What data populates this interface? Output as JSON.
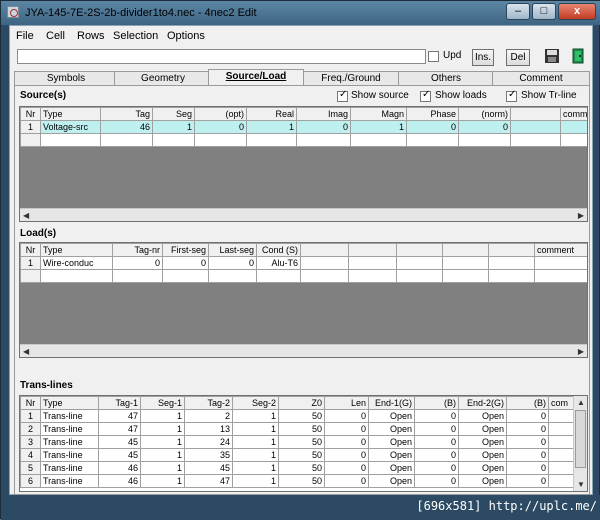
{
  "window": {
    "title": "JYA-145-7E-2S-2b-divider1to4.nec - 4nec2 Edit",
    "minimize": "–",
    "maximize": "□",
    "close": "x"
  },
  "menu": [
    "File",
    "Cell",
    "Rows",
    "Selection",
    "Options"
  ],
  "toolbar": {
    "command_value": "",
    "upd_label": "Upd",
    "upd_checked": false,
    "ins_label": "Ins.",
    "del_label": "Del"
  },
  "tabs": [
    "Symbols",
    "Geometry",
    "Source/Load",
    "Freq./Ground",
    "Others",
    "Comment"
  ],
  "active_tab": "Source/Load",
  "sources": {
    "title": "Source(s)",
    "show_source": "Show source",
    "show_loads": "Show loads",
    "show_trline": "Show Tr-line",
    "headers": [
      "Nr",
      "Type",
      "Tag",
      "Seg",
      "(opt)",
      "Real",
      "Imag",
      "Magn",
      "Phase",
      "(norm)",
      "",
      "comm"
    ],
    "rows": [
      [
        "1",
        "Voltage-src",
        "46",
        "1",
        "0",
        "1",
        "0",
        "1",
        "0",
        "0",
        "",
        ""
      ],
      [
        "",
        "",
        "",
        "",
        "",
        "",
        "",
        "",
        "",
        "",
        "",
        ""
      ]
    ]
  },
  "loads": {
    "title": "Load(s)",
    "headers": [
      "Nr",
      "Type",
      "Tag-nr",
      "First-seg",
      "Last-seg",
      "Cond (S)",
      "",
      "",
      "",
      "",
      "",
      "comment"
    ],
    "rows": [
      [
        "1",
        "Wire-conduc",
        "0",
        "0",
        "0",
        "Alu-T6",
        "",
        "",
        "",
        "",
        "",
        ""
      ],
      [
        "",
        "",
        "",
        "",
        "",
        "",
        "",
        "",
        "",
        "",
        "",
        ""
      ]
    ]
  },
  "translines": {
    "title": "Trans-lines",
    "headers": [
      "Nr",
      "Type",
      "Tag-1",
      "Seg-1",
      "Tag-2",
      "Seg-2",
      "Z0",
      "Len",
      "End-1(G)",
      "(B)",
      "End-2(G)",
      "(B)",
      "com"
    ],
    "rows": [
      [
        "1",
        "Trans-line",
        "47",
        "1",
        "2",
        "1",
        "50",
        "0",
        "Open",
        "0",
        "Open",
        "0",
        ""
      ],
      [
        "2",
        "Trans-line",
        "47",
        "1",
        "13",
        "1",
        "50",
        "0",
        "Open",
        "0",
        "Open",
        "0",
        ""
      ],
      [
        "3",
        "Trans-line",
        "45",
        "1",
        "24",
        "1",
        "50",
        "0",
        "Open",
        "0",
        "Open",
        "0",
        ""
      ],
      [
        "4",
        "Trans-line",
        "45",
        "1",
        "35",
        "1",
        "50",
        "0",
        "Open",
        "0",
        "Open",
        "0",
        ""
      ],
      [
        "5",
        "Trans-line",
        "46",
        "1",
        "45",
        "1",
        "50",
        "0",
        "Open",
        "0",
        "Open",
        "0",
        ""
      ],
      [
        "6",
        "Trans-line",
        "46",
        "1",
        "47",
        "1",
        "50",
        "0",
        "Open",
        "0",
        "Open",
        "0",
        ""
      ]
    ]
  },
  "watermark": "[696x581] http://uplc.me/",
  "colors": {
    "selected_row": "#bff0f0",
    "grid_empty": "#808080",
    "titlebar": "#4a7293"
  }
}
